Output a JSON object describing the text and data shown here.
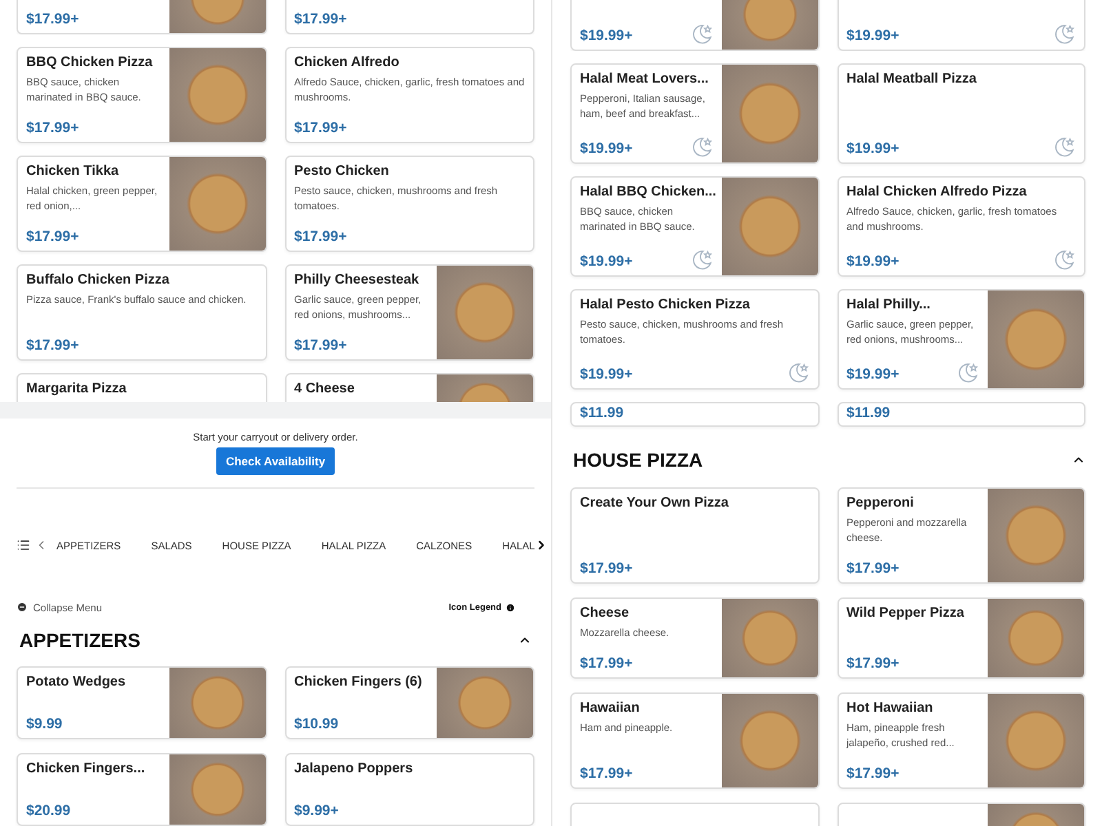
{
  "left_panel": {
    "rows": [
      {
        "kind": "clipped",
        "cards": [
          {
            "price": "$17.99+",
            "photo": true,
            "halal": false
          },
          {
            "price": "$17.99+",
            "photo": false,
            "halal": false
          }
        ]
      },
      {
        "kind": "full",
        "cards": [
          {
            "name": "BBQ Chicken Pizza",
            "description": "BBQ sauce, chicken marinated in BBQ sauce.",
            "price": "$17.99+",
            "photo": true,
            "halal": false
          },
          {
            "name": "Chicken Alfredo",
            "description": "Alfredo Sauce, chicken, garlic, fresh tomatoes and mushrooms.",
            "price": "$17.99+",
            "photo": false,
            "halal": false
          }
        ]
      },
      {
        "kind": "full",
        "cards": [
          {
            "name": "Chicken Tikka",
            "description": "Halal chicken, green pepper, red onion,...",
            "price": "$17.99+",
            "photo": true,
            "halal": false
          },
          {
            "name": "Pesto Chicken",
            "description": "Pesto sauce, chicken, mushrooms and fresh tomatoes.",
            "price": "$17.99+",
            "photo": false,
            "halal": false
          }
        ]
      },
      {
        "kind": "full",
        "cards": [
          {
            "name": "Buffalo Chicken Pizza",
            "description": "Pizza sauce, Frank's buffalo sauce and chicken.",
            "price": "$17.99+",
            "photo": false,
            "halal": false
          },
          {
            "name": "Philly Cheesesteak",
            "description": "Garlic sauce, green pepper, red onions, mushrooms...",
            "price": "$17.99+",
            "photo": true,
            "halal": false
          }
        ]
      },
      {
        "kind": "full",
        "cards": [
          {
            "name": "Margarita Pizza",
            "photo": false,
            "halal": false
          },
          {
            "name": "4 Cheese",
            "photo": true,
            "halal": false
          }
        ]
      }
    ],
    "order_prompt": "Start your carryout or delivery order.",
    "order_button": "Check Availability",
    "category_nav": [
      "APPETIZERS",
      "SALADS",
      "HOUSE PIZZA",
      "HALAL PIZZA",
      "CALZONES",
      "HALAL"
    ],
    "collapse_label": "Collapse Menu",
    "legend_label": "Icon Legend",
    "section": {
      "title": "APPETIZERS",
      "rows": [
        {
          "kind": "full",
          "cards": [
            {
              "name": "Potato Wedges",
              "price": "$9.99",
              "photo": true,
              "halal": false
            },
            {
              "name": "Chicken Fingers (6)",
              "price": "$10.99",
              "photo": true,
              "halal": false
            }
          ]
        },
        {
          "kind": "full",
          "cards": [
            {
              "name": "Chicken Fingers...",
              "price": "$20.99",
              "photo": true,
              "halal": false
            },
            {
              "name": "Jalapeno Poppers",
              "price": "$9.99+",
              "photo": false,
              "halal": false
            }
          ]
        }
      ]
    }
  },
  "right_panel": {
    "rows": [
      {
        "kind": "clipped",
        "cards": [
          {
            "price": "$19.99+",
            "photo": true,
            "halal": true
          },
          {
            "price": "$19.99+",
            "photo": false,
            "halal": true
          }
        ]
      },
      {
        "kind": "full",
        "cards": [
          {
            "name": "Halal Meat Lovers...",
            "description": "Pepperoni, Italian sausage, ham, beef and breakfast...",
            "price": "$19.99+",
            "photo": true,
            "halal": true
          },
          {
            "name": "Halal Meatball Pizza",
            "price": "$19.99+",
            "photo": false,
            "halal": true
          }
        ]
      },
      {
        "kind": "full",
        "cards": [
          {
            "name": "Halal BBQ Chicken...",
            "description": "BBQ sauce, chicken marinated in BBQ sauce.",
            "price": "$19.99+",
            "photo": true,
            "halal": true
          },
          {
            "name": "Halal Chicken Alfredo Pizza",
            "description": "Alfredo Sauce, chicken, garlic, fresh tomatoes and mushrooms.",
            "price": "$19.99+",
            "photo": false,
            "halal": true
          }
        ]
      },
      {
        "kind": "full",
        "cards": [
          {
            "name": "Halal Pesto Chicken Pizza",
            "description": "Pesto sauce, chicken, mushrooms and fresh tomatoes.",
            "price": "$19.99+",
            "photo": false,
            "halal": true
          },
          {
            "name": "Halal Philly...",
            "description": "Garlic sauce, green pepper, red onions, mushrooms...",
            "price": "$19.99+",
            "photo": true,
            "halal": true
          }
        ]
      },
      {
        "kind": "stub",
        "cards": [
          {
            "price": "$11.99",
            "photo": false,
            "halal": false
          },
          {
            "price": "$11.99",
            "photo": false,
            "halal": false
          }
        ]
      }
    ],
    "section": {
      "title": "HOUSE PIZZA",
      "rows": [
        {
          "kind": "full",
          "cards": [
            {
              "name": "Create Your Own Pizza",
              "price": "$17.99+",
              "photo": false,
              "halal": false
            },
            {
              "name": "Pepperoni",
              "description": "Pepperoni and mozzarella cheese.",
              "price": "$17.99+",
              "photo": true,
              "halal": false
            }
          ]
        },
        {
          "kind": "full",
          "cards": [
            {
              "name": "Cheese",
              "description": "Mozzarella cheese.",
              "price": "$17.99+",
              "photo": true,
              "halal": false
            },
            {
              "name": "Wild Pepper Pizza",
              "price": "$17.99+",
              "photo": true,
              "halal": false
            }
          ]
        },
        {
          "kind": "full",
          "cards": [
            {
              "name": "Hawaiian",
              "description": "Ham and pineapple.",
              "price": "$17.99+",
              "photo": true,
              "halal": false
            },
            {
              "name": "Hot Hawaiian",
              "description": "Ham, pineapple fresh jalapeño, crushed red...",
              "price": "$17.99+",
              "photo": true,
              "halal": false
            }
          ]
        },
        {
          "kind": "full",
          "cards": [
            {
              "photo": false,
              "halal": false
            },
            {
              "photo": true,
              "halal": false
            }
          ]
        }
      ]
    }
  }
}
